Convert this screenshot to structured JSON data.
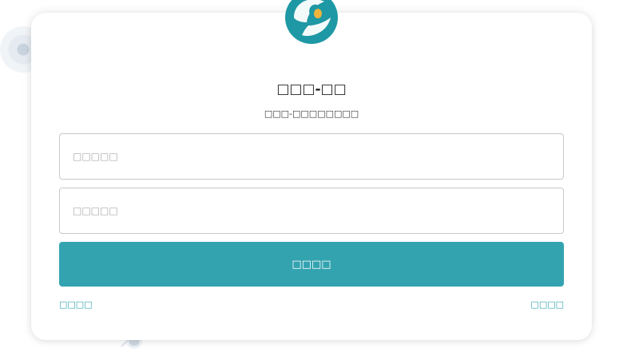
{
  "app": {
    "title": "□□□-□□",
    "subtitle": "□□□-□□□□□□□□"
  },
  "form": {
    "username_placeholder": "□□□□□",
    "password_placeholder": "□□□□□",
    "submit_label": "□□□□",
    "left_link": "□□□□",
    "right_link": "□□□□"
  },
  "colors": {
    "accent": "#34a3b0",
    "logo_primary": "#1e98a4",
    "logo_center": "#f0b43c",
    "background": "#ffffff"
  },
  "icons": {
    "logo": "leaf-seed-logo-icon"
  }
}
